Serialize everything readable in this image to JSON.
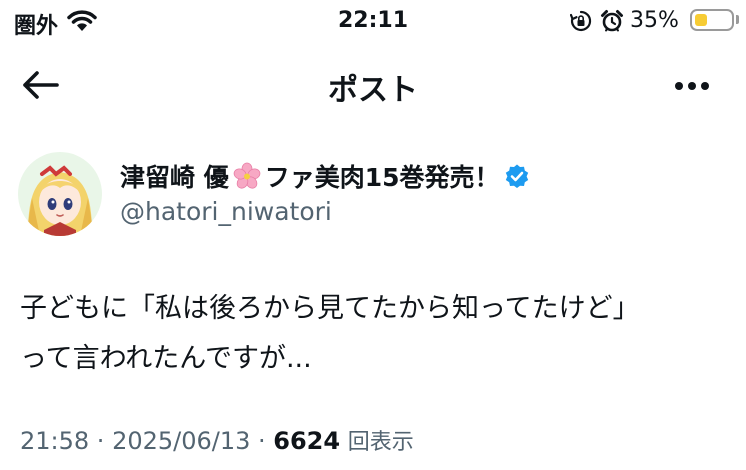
{
  "status_bar": {
    "carrier": "圏外",
    "time": "22:11",
    "battery_percent": "35%",
    "battery_level": 0.35,
    "icons": [
      "wifi-icon",
      "orientation-lock-icon",
      "alarm-icon",
      "battery-icon"
    ]
  },
  "header": {
    "title": "ポスト",
    "back_icon": "arrow-left-icon",
    "more_icon": "more-horizontal-icon"
  },
  "author": {
    "name_part1": "津留崎 優",
    "name_part2": "ファ美肉15巻発売！",
    "handle": "@hatori_niwatori",
    "verified": true,
    "name_emoji": "cherry-blossom-icon"
  },
  "post": {
    "line1": "子どもに「私は後ろから見てたから知ってたけど」",
    "line2": "って言われたんですが..."
  },
  "meta": {
    "time": "21:58",
    "sep1": " · ",
    "date": "2025/06/13",
    "sep2": " · ",
    "views_count": "6624",
    "views_label": "回表示"
  },
  "colors": {
    "text": "#0f1419",
    "secondary": "#536471",
    "verified": "#1d9bf0",
    "battery_fill": "#f7cc34"
  }
}
